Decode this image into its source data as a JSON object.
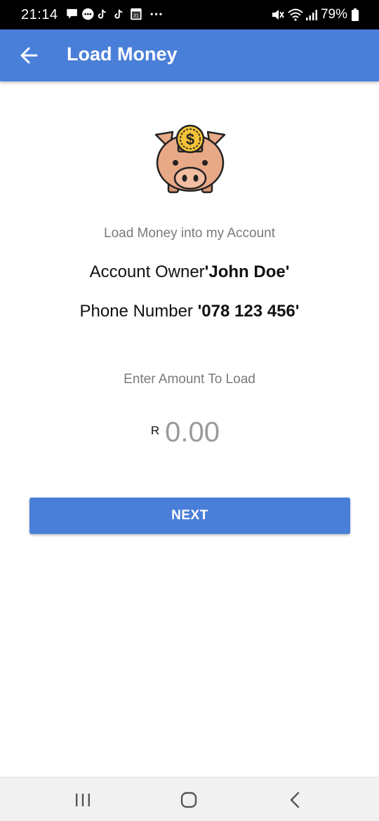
{
  "status_bar": {
    "time": "21:14",
    "battery": "79%",
    "icons_left": [
      "message-icon",
      "chat-bubble-icon",
      "tiktok-icon",
      "tiktok-icon",
      "calendar-icon",
      "more-dots-icon"
    ],
    "calendar_day": "31",
    "icons_right": [
      "mute-icon",
      "wifi-icon",
      "signal-icon",
      "battery-icon"
    ]
  },
  "app_bar": {
    "title": "Load Money",
    "back_icon": "arrow-left-icon",
    "color": "#4a7fd9"
  },
  "hero": {
    "icon": "piggy-bank-dollar-icon"
  },
  "content": {
    "subtitle": "Load Money into my Account",
    "owner_prefix": "Account Owner",
    "owner_name": "'John Doe'",
    "phone_prefix": "Phone Number ",
    "phone_number": "'078 123 456'",
    "amount_label": "Enter Amount To Load",
    "currency_symbol": "R",
    "amount_placeholder": "0.00",
    "amount_value": ""
  },
  "actions": {
    "next_label": "NEXT",
    "button_color": "#4a7fd9"
  },
  "nav_bar": {
    "recents_icon": "recents-icon",
    "home_icon": "home-icon",
    "back_icon": "back-chevron-icon"
  }
}
